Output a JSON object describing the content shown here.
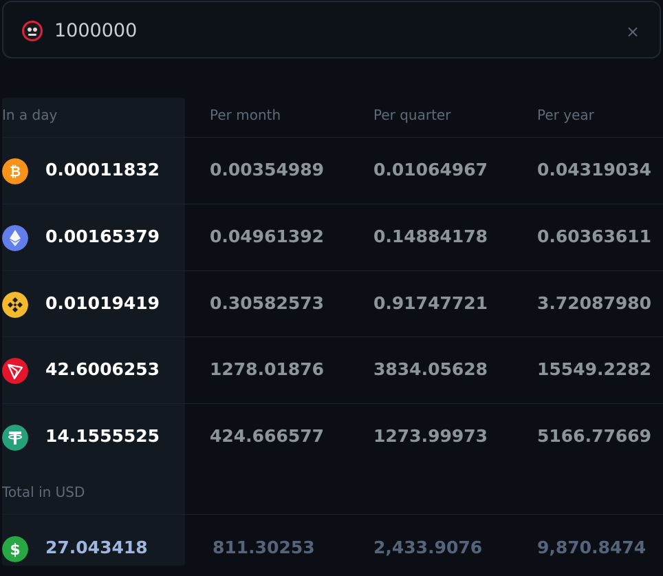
{
  "search": {
    "value": "1000000",
    "clear_symbol": "×"
  },
  "columns": [
    "In a day",
    "Per month",
    "Per quarter",
    "Per year"
  ],
  "rows": [
    {
      "coin": "bitcoin",
      "color": "#f7931a",
      "values": [
        "0.00011832",
        "0.00354989",
        "0.01064967",
        "0.04319034"
      ]
    },
    {
      "coin": "ethereum",
      "color": "#627eea",
      "values": [
        "0.00165379",
        "0.04961392",
        "0.14884178",
        "0.60363611"
      ]
    },
    {
      "coin": "bnb",
      "color": "#f3ba2f",
      "values": [
        "0.01019419",
        "0.30582573",
        "0.91747721",
        "3.72087980"
      ]
    },
    {
      "coin": "tron",
      "color": "#e5162c",
      "values": [
        "42.6006253",
        "1278.01876",
        "3834.05628",
        "15549.2282"
      ]
    },
    {
      "coin": "tether",
      "color": "#26a17b",
      "values": [
        "14.1555525",
        "424.666577",
        "1273.99973",
        "5166.77669"
      ]
    }
  ],
  "total": {
    "label": "Total in USD",
    "color": "#27a844",
    "values": [
      "27.043418",
      "811.30253",
      "2,433.9076",
      "9,870.8474"
    ]
  }
}
